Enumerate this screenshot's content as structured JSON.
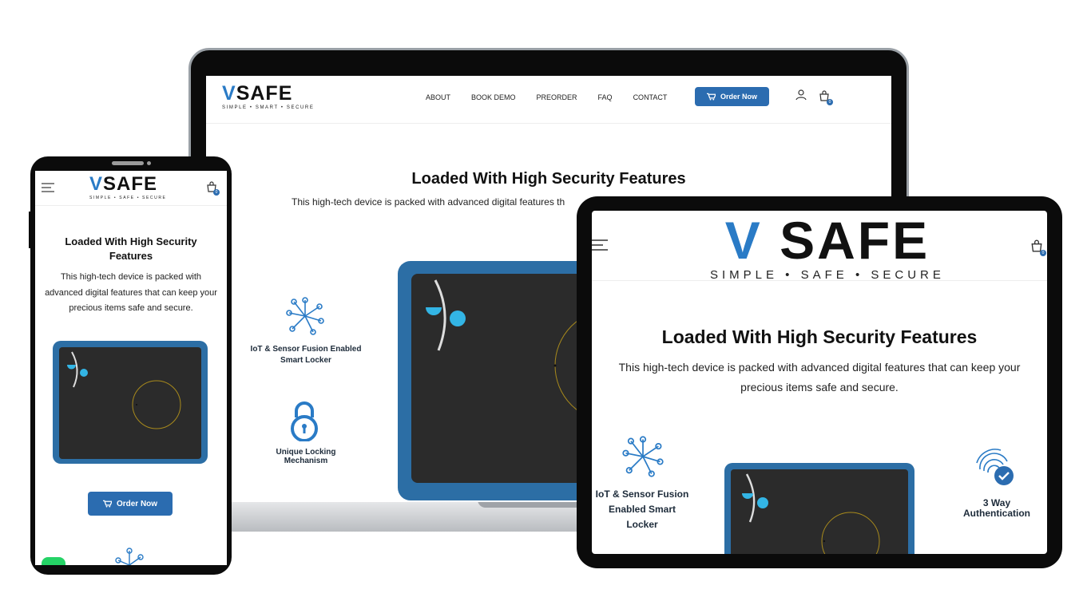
{
  "brand": {
    "name_v": "V",
    "name_rest": "SAFE",
    "tagline_laptop": "SIMPLE • SMART • SECURE",
    "tagline_phone": "SIMPLE • SAFE • SECURE",
    "tagline_tablet": "SIMPLE • SAFE • SECURE",
    "accent_color": "#2a7bc6"
  },
  "nav": {
    "items": [
      {
        "label": "ABOUT"
      },
      {
        "label": "BOOK DEMO"
      },
      {
        "label": "PREORDER"
      },
      {
        "label": "FAQ"
      },
      {
        "label": "CONTACT"
      }
    ],
    "order_button": "Order Now",
    "cart_count": "0",
    "icons": [
      "user-icon",
      "shopping-bag-icon",
      "menu-icon",
      "cart-icon"
    ]
  },
  "hero": {
    "title": "Loaded With High Security Features",
    "desc_laptop": "This high-tech device is packed with advanced digital features th",
    "desc_full": "This high-tech device is packed with advanced digital features that can keep your precious items safe and secure.",
    "button_color": "#2b6cb0"
  },
  "features": {
    "iot": "IoT & Sensor Fusion Enabled Smart Locker",
    "lock": "Unique Locking Mechanism",
    "auth": "3 Way Authentication"
  }
}
